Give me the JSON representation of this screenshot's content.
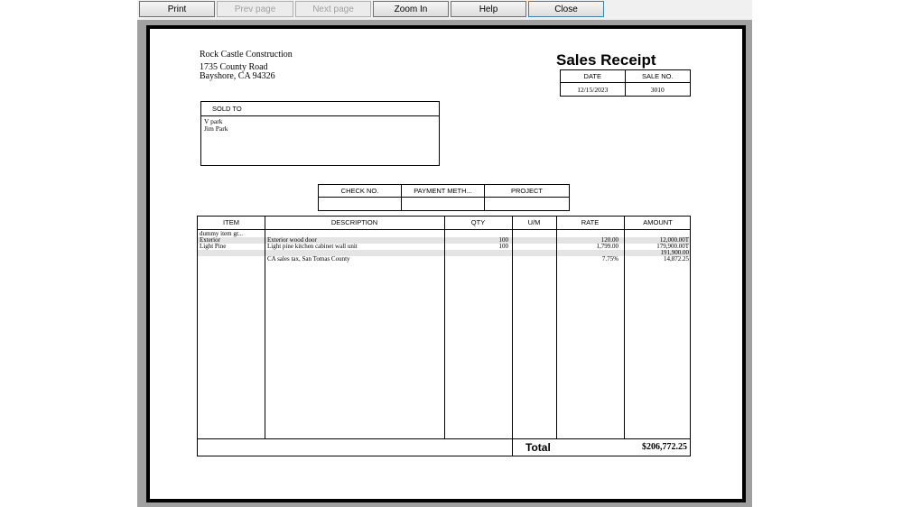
{
  "toolbar": {
    "buttons": [
      {
        "label": "Print"
      },
      {
        "label": "Prev page"
      },
      {
        "label": "Next page"
      },
      {
        "label": "Zoom In"
      },
      {
        "label": "Help"
      },
      {
        "label": "Close"
      }
    ]
  },
  "receipt": {
    "company": "Rock Castle Construction",
    "address_line1": "1735 County Road",
    "address_line2": "Bayshore, CA 94326",
    "title": "Sales Receipt",
    "date_label": "DATE",
    "sale_no_label": "SALE NO.",
    "date": "12/15/2023",
    "sale_no": "3010",
    "sold_to_label": "SOLD TO",
    "sold_to_lines": [
      "V park",
      "Jim Park"
    ],
    "check_no_label": "CHECK NO.",
    "payment_method_label": "PAYMENT METH...",
    "project_label": "PROJECT",
    "columns": {
      "item": "ITEM",
      "description": "DESCRIPTION",
      "qty": "QTY",
      "um": "U/M",
      "rate": "RATE",
      "amount": "AMOUNT"
    },
    "lines": [
      {
        "item": "dummy item gr...",
        "description": "",
        "qty": "",
        "um": "",
        "rate": "",
        "amount": ""
      },
      {
        "item": "Exterior",
        "description": "Exterior wood door",
        "qty": "100",
        "um": "",
        "rate": "120.00",
        "amount": "12,000.00T"
      },
      {
        "item": "Light Pine",
        "description": "Light pine kitchen cabinet wall unit",
        "qty": "100",
        "um": "",
        "rate": "1,799.00",
        "amount": "179,900.00T"
      },
      {
        "item": "",
        "description": "",
        "qty": "",
        "um": "",
        "rate": "",
        "amount": "191,900.00"
      },
      {
        "item": "",
        "description": "CA sales tax, San Tomas County",
        "qty": "",
        "um": "",
        "rate": "7.75%",
        "amount": "14,872.25"
      }
    ],
    "total_label": "Total",
    "total_value": "$206,772.25"
  }
}
